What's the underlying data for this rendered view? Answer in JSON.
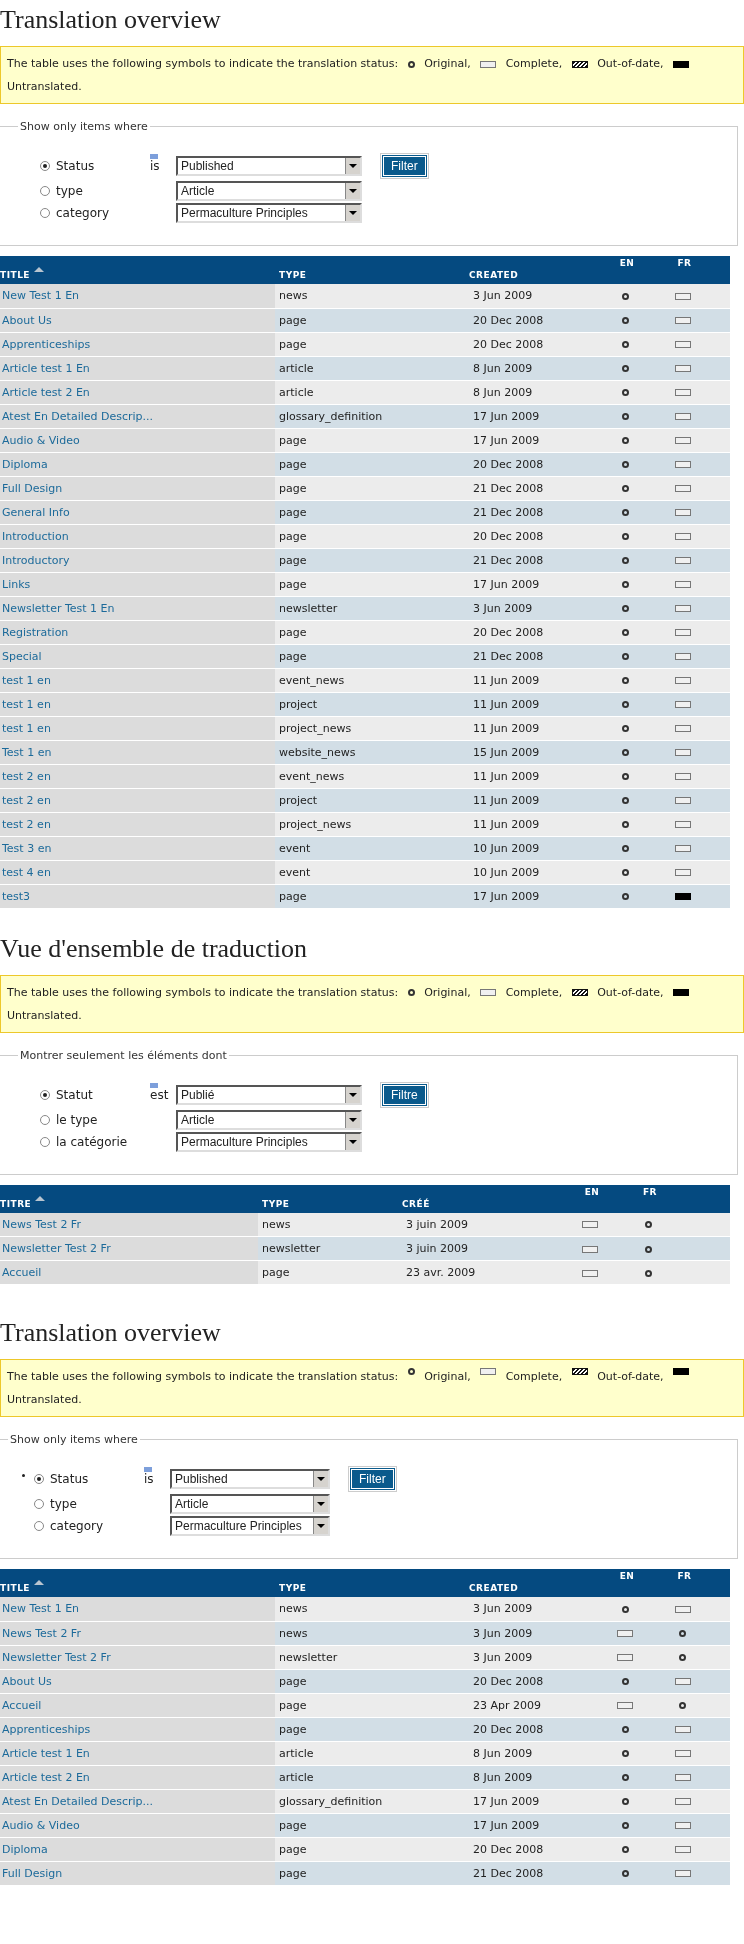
{
  "sections": [
    {
      "heading": "Translation overview",
      "legend": {
        "intro": "The table uses the following symbols to indicate the translation status:",
        "icons_raised": false,
        "items": [
          {
            "kind": "original",
            "label": "Original,"
          },
          {
            "kind": "complete",
            "label": "Complete,"
          },
          {
            "kind": "outdated",
            "label": "Out-of-date,"
          },
          {
            "kind": "untranslated",
            "label": "Untranslated."
          }
        ]
      },
      "filter": {
        "title": "Show only items where",
        "operator": "is",
        "button": "Filter",
        "options": [
          {
            "label": "Status",
            "selected": true,
            "value": "Published"
          },
          {
            "label": "type",
            "selected": false,
            "value": "Article"
          },
          {
            "label": "category",
            "selected": false,
            "value": "Permaculture Principles"
          }
        ]
      },
      "table": {
        "columns": [
          {
            "label": "TITLE",
            "sorted": true
          },
          {
            "label": "TYPE",
            "sorted": false
          },
          {
            "label": "CREATED",
            "sorted": false
          },
          {
            "label": "EN",
            "sorted": false
          },
          {
            "label": "FR",
            "sorted": false
          }
        ],
        "rows": [
          {
            "title": "New Test 1 En",
            "type": "news",
            "created": "3 Jun 2009",
            "en": {
              "kind": "original"
            },
            "fr": {
              "kind": "complete"
            }
          },
          {
            "title": "About Us",
            "type": "page",
            "created": "20 Dec 2008",
            "en": {
              "kind": "original"
            },
            "fr": {
              "kind": "complete"
            }
          },
          {
            "title": "Apprenticeships",
            "type": "page",
            "created": "20 Dec 2008",
            "en": {
              "kind": "original"
            },
            "fr": {
              "kind": "complete"
            }
          },
          {
            "title": "Article test 1 En",
            "type": "article",
            "created": "8 Jun 2009",
            "en": {
              "kind": "original"
            },
            "fr": {
              "kind": "complete"
            }
          },
          {
            "title": "Article test 2 En",
            "type": "article",
            "created": "8 Jun 2009",
            "en": {
              "kind": "original"
            },
            "fr": {
              "kind": "complete"
            }
          },
          {
            "title": "Atest En Detailed Descrip...",
            "type": "glossary_definition",
            "created": "17 Jun 2009",
            "en": {
              "kind": "original"
            },
            "fr": {
              "kind": "complete"
            }
          },
          {
            "title": "Audio & Video",
            "type": "page",
            "created": "17 Jun 2009",
            "en": {
              "kind": "original"
            },
            "fr": {
              "kind": "complete"
            }
          },
          {
            "title": "Diploma",
            "type": "page",
            "created": "20 Dec 2008",
            "en": {
              "kind": "original"
            },
            "fr": {
              "kind": "complete"
            }
          },
          {
            "title": "Full Design",
            "type": "page",
            "created": "21 Dec 2008",
            "en": {
              "kind": "original"
            },
            "fr": {
              "kind": "complete"
            }
          },
          {
            "title": "General Info",
            "type": "page",
            "created": "21 Dec 2008",
            "en": {
              "kind": "original"
            },
            "fr": {
              "kind": "complete"
            }
          },
          {
            "title": "Introduction",
            "type": "page",
            "created": "20 Dec 2008",
            "en": {
              "kind": "original"
            },
            "fr": {
              "kind": "complete"
            }
          },
          {
            "title": "Introductory",
            "type": "page",
            "created": "21 Dec 2008",
            "en": {
              "kind": "original"
            },
            "fr": {
              "kind": "complete"
            }
          },
          {
            "title": "Links",
            "type": "page",
            "created": "17 Jun 2009",
            "en": {
              "kind": "original"
            },
            "fr": {
              "kind": "complete"
            }
          },
          {
            "title": "Newsletter Test 1 En",
            "type": "newsletter",
            "created": "3 Jun 2009",
            "en": {
              "kind": "original"
            },
            "fr": {
              "kind": "complete"
            }
          },
          {
            "title": "Registration",
            "type": "page",
            "created": "20 Dec 2008",
            "en": {
              "kind": "original"
            },
            "fr": {
              "kind": "complete"
            }
          },
          {
            "title": "Special",
            "type": "page",
            "created": "21 Dec 2008",
            "en": {
              "kind": "original"
            },
            "fr": {
              "kind": "complete"
            }
          },
          {
            "title": "test 1 en",
            "type": "event_news",
            "created": "11 Jun 2009",
            "en": {
              "kind": "original"
            },
            "fr": {
              "kind": "complete"
            }
          },
          {
            "title": "test 1 en",
            "type": "project",
            "created": "11 Jun 2009",
            "en": {
              "kind": "original"
            },
            "fr": {
              "kind": "complete"
            }
          },
          {
            "title": "test 1 en",
            "type": "project_news",
            "created": "11 Jun 2009",
            "en": {
              "kind": "original"
            },
            "fr": {
              "kind": "complete"
            }
          },
          {
            "title": "Test 1 en",
            "type": "website_news",
            "created": "15 Jun 2009",
            "en": {
              "kind": "original"
            },
            "fr": {
              "kind": "complete"
            }
          },
          {
            "title": "test 2 en",
            "type": "event_news",
            "created": "11 Jun 2009",
            "en": {
              "kind": "original"
            },
            "fr": {
              "kind": "complete"
            }
          },
          {
            "title": "test 2 en",
            "type": "project",
            "created": "11 Jun 2009",
            "en": {
              "kind": "original"
            },
            "fr": {
              "kind": "complete"
            }
          },
          {
            "title": "test 2 en",
            "type": "project_news",
            "created": "11 Jun 2009",
            "en": {
              "kind": "original"
            },
            "fr": {
              "kind": "complete"
            }
          },
          {
            "title": "Test 3 en",
            "type": "event",
            "created": "10 Jun 2009",
            "en": {
              "kind": "original"
            },
            "fr": {
              "kind": "complete"
            }
          },
          {
            "title": "test 4 en",
            "type": "event",
            "created": "10 Jun 2009",
            "en": {
              "kind": "original"
            },
            "fr": {
              "kind": "complete"
            }
          },
          {
            "title": "test3",
            "type": "page",
            "created": "17 Jun 2009",
            "en": {
              "kind": "original"
            },
            "fr": {
              "kind": "untranslated"
            }
          }
        ]
      }
    },
    {
      "heading": "Vue d'ensemble de traduction",
      "legend": {
        "intro": "The table uses the following symbols to indicate the translation status:",
        "icons_raised": false,
        "items": [
          {
            "kind": "original",
            "label": "Original,"
          },
          {
            "kind": "complete",
            "label": "Complete,"
          },
          {
            "kind": "outdated",
            "label": "Out-of-date,"
          },
          {
            "kind": "untranslated",
            "label": "Untranslated."
          }
        ]
      },
      "filter": {
        "title": "Montrer seulement les éléments dont",
        "operator": "est",
        "button": "Filtre",
        "options": [
          {
            "label": "Statut",
            "selected": true,
            "value": "Publié"
          },
          {
            "label": "le type",
            "selected": false,
            "value": "Article"
          },
          {
            "label": "la catégorie",
            "selected": false,
            "value": "Permaculture Principles"
          }
        ]
      },
      "table": {
        "columns": [
          {
            "label": "TITRE",
            "sorted": true
          },
          {
            "label": "TYPE",
            "sorted": false
          },
          {
            "label": "CRÉÉ",
            "sorted": false
          },
          {
            "label": "EN",
            "sorted": false
          },
          {
            "label": "FR",
            "sorted": false
          }
        ],
        "rows": [
          {
            "title": "News Test 2 Fr",
            "type": "news",
            "created": "3 juin 2009",
            "en": {
              "kind": "complete"
            },
            "fr": {
              "kind": "original"
            }
          },
          {
            "title": "Newsletter Test 2 Fr",
            "type": "newsletter",
            "created": "3 juin 2009",
            "en": {
              "kind": "complete"
            },
            "fr": {
              "kind": "original"
            }
          },
          {
            "title": "Accueil",
            "type": "page",
            "created": "23 avr. 2009",
            "en": {
              "kind": "complete"
            },
            "fr": {
              "kind": "original"
            }
          }
        ]
      }
    },
    {
      "heading": "Translation overview",
      "legend": {
        "intro": "The table uses the following symbols to indicate the translation status:",
        "icons_raised": true,
        "items": [
          {
            "kind": "original",
            "label": "Original,"
          },
          {
            "kind": "complete",
            "label": "Complete,"
          },
          {
            "kind": "outdated",
            "label": "Out-of-date,"
          },
          {
            "kind": "untranslated",
            "label": "Untranslated."
          }
        ]
      },
      "filter": {
        "title": "Show only items where",
        "operator": "is",
        "bullet": true,
        "button": "Filter",
        "options": [
          {
            "label": "Status",
            "selected": true,
            "value": "Published"
          },
          {
            "label": "type",
            "selected": false,
            "value": "Article"
          },
          {
            "label": "category",
            "selected": false,
            "value": "Permaculture Principles"
          }
        ]
      },
      "table": {
        "columns": [
          {
            "label": "TITLE",
            "sorted": true
          },
          {
            "label": "TYPE",
            "sorted": false
          },
          {
            "label": "CREATED",
            "sorted": false
          },
          {
            "label": "EN",
            "sorted": false
          },
          {
            "label": "FR",
            "sorted": false
          }
        ],
        "rows": [
          {
            "title": "New Test 1 En",
            "type": "news",
            "created": "3 Jun 2009",
            "en": {
              "kind": "original"
            },
            "fr": {
              "kind": "complete"
            }
          },
          {
            "title": "News Test 2 Fr",
            "type": "news",
            "created": "3 Jun 2009",
            "en": {
              "kind": "complete"
            },
            "fr": {
              "kind": "original"
            }
          },
          {
            "title": "Newsletter Test 2 Fr",
            "type": "newsletter",
            "created": "3 Jun 2009",
            "en": {
              "kind": "complete"
            },
            "fr": {
              "kind": "original"
            }
          },
          {
            "title": "About Us",
            "type": "page",
            "created": "20 Dec 2008",
            "en": {
              "kind": "original"
            },
            "fr": {
              "kind": "complete"
            }
          },
          {
            "title": "Accueil",
            "type": "page",
            "created": "23 Apr 2009",
            "en": {
              "kind": "complete"
            },
            "fr": {
              "kind": "original"
            }
          },
          {
            "title": "Apprenticeships",
            "type": "page",
            "created": "20 Dec 2008",
            "en": {
              "kind": "original"
            },
            "fr": {
              "kind": "complete"
            }
          },
          {
            "title": "Article test 1 En",
            "type": "article",
            "created": "8 Jun 2009",
            "en": {
              "kind": "original"
            },
            "fr": {
              "kind": "complete"
            }
          },
          {
            "title": "Article test 2 En",
            "type": "article",
            "created": "8 Jun 2009",
            "en": {
              "kind": "original"
            },
            "fr": {
              "kind": "complete"
            }
          },
          {
            "title": "Atest En Detailed Descrip...",
            "type": "glossary_definition",
            "created": "17 Jun 2009",
            "en": {
              "kind": "original"
            },
            "fr": {
              "kind": "complete"
            }
          },
          {
            "title": "Audio & Video",
            "type": "page",
            "created": "17 Jun 2009",
            "en": {
              "kind": "original"
            },
            "fr": {
              "kind": "complete"
            }
          },
          {
            "title": "Diploma",
            "type": "page",
            "created": "20 Dec 2008",
            "en": {
              "kind": "original"
            },
            "fr": {
              "kind": "complete"
            }
          },
          {
            "title": "Full Design",
            "type": "page",
            "created": "21 Dec 2008",
            "en": {
              "kind": "original"
            },
            "fr": {
              "kind": "complete"
            }
          }
        ]
      }
    }
  ]
}
